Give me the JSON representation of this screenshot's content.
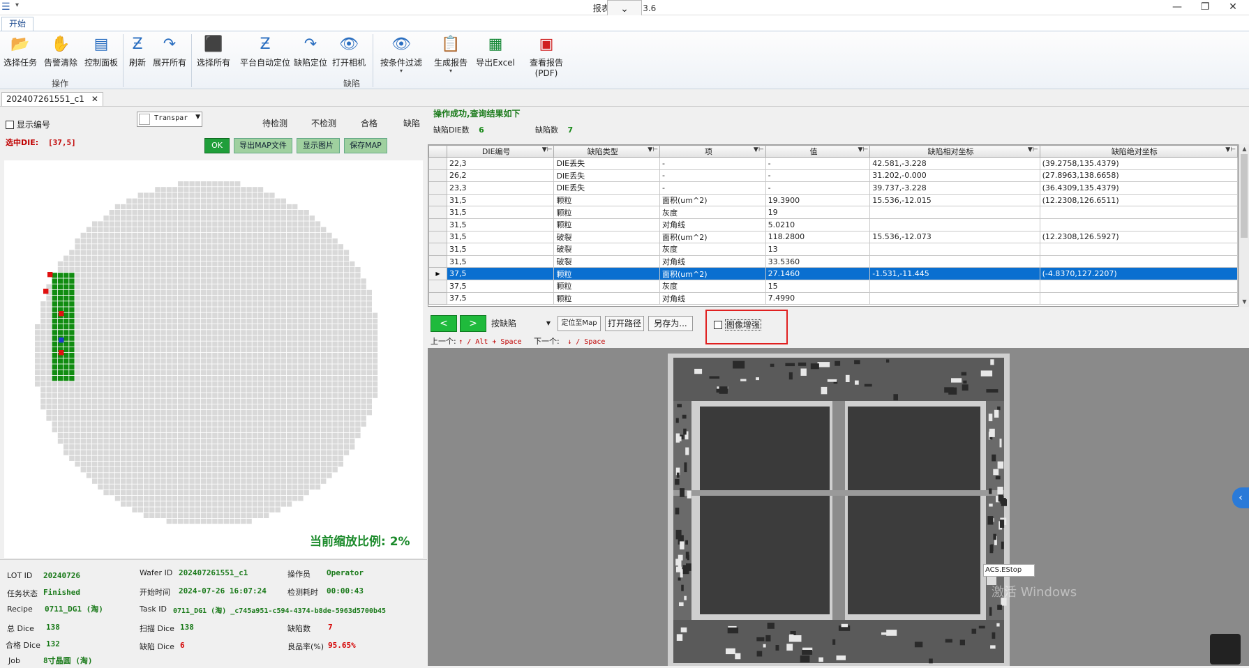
{
  "titlebar": {
    "title": "报表中心 V4.3.6",
    "restore": "❐",
    "minimize": "—",
    "close": "✕"
  },
  "ribbon": {
    "tab": "开始",
    "groups": [
      {
        "label": "操作"
      },
      {
        "label": "缺陷"
      }
    ],
    "buttons": {
      "select_task": "选择任务",
      "alarm_clear": "告警清除",
      "control_panel": "控制面板",
      "refresh": "刷新",
      "expand_all": "展开所有",
      "select_all": "选择所有",
      "platform_auto": "平台自动定位",
      "defect_locate": "缺陷定位",
      "open_camera": "打开相机",
      "filter_by": "按条件过滤",
      "gen_report": "生成报告",
      "export_excel": "导出Excel",
      "view_report_pdf": "查看报告(PDF)"
    }
  },
  "doc_tab": {
    "label": "202407261551_c1",
    "close": "✕"
  },
  "left": {
    "show_number": "显示编号",
    "transparency": "Transpar",
    "legend": [
      "待检测",
      "不检测",
      "合格",
      "缺陷"
    ],
    "selected_die_label": "选中DIE:",
    "selected_die_value": "[37,5]",
    "btn_ok": "OK",
    "btn_export_map": "导出MAP文件",
    "btn_show_image": "显示图片",
    "btn_save_map": "保存MAP",
    "zoom_text": "当前缩放比例: 2%"
  },
  "info": {
    "lot_id_label": "LOT ID",
    "lot_id": "20240726",
    "wafer_id_label": "Wafer ID",
    "wafer_id": "202407261551_c1",
    "operator_label": "操作员",
    "operator": "Operator",
    "task_status_label": "任务状态",
    "task_status": "Finished",
    "start_time_label": "开始时间",
    "start_time": "2024-07-26 16:07:24",
    "elapsed_label": "检测耗时",
    "elapsed": "00:00:43",
    "recipe_label": "Recipe",
    "recipe": "0711_DG1 (淘)",
    "task_id_label": "Task ID",
    "task_id": "0711_DG1 (淘) _c745a951-c594-4374-b8de-5963d5700b45",
    "total_dice_label": "总 Dice",
    "total_dice": "138",
    "scan_dice_label": "扫描 Dice",
    "scan_dice": "138",
    "defect_count_label": "缺陷数",
    "defect_count": "7",
    "good_dice_label": "合格 Dice",
    "good_dice": "132",
    "defect_dice_label": "缺陷 Dice",
    "defect_dice": "6",
    "yield_label": "良品率(%)",
    "yield": "95.65%",
    "job_label": "Job",
    "job": "8寸晶圆 (淘)"
  },
  "right": {
    "result_msg": "操作成功,查询结果如下",
    "defect_die_label": "缺陷DIE数",
    "defect_die": "6",
    "defect_num_label": "缺陷数",
    "defect_num": "7",
    "columns": [
      "DIE编号",
      "缺陷类型",
      "项",
      "值",
      "缺陷相对坐标",
      "缺陷绝对坐标"
    ],
    "rows": [
      {
        "die": "22,3",
        "type": "DIE丢失",
        "item": "-",
        "val": "-",
        "rel": "42.581,-3.228",
        "abs": "(39.2758,135.4379)"
      },
      {
        "die": "26,2",
        "type": "DIE丢失",
        "item": "-",
        "val": "-",
        "rel": "31.202,-0.000",
        "abs": "(27.8963,138.6658)"
      },
      {
        "die": "23,3",
        "type": "DIE丢失",
        "item": "-",
        "val": "-",
        "rel": "39.737,-3.228",
        "abs": "(36.4309,135.4379)"
      },
      {
        "die": "31,5",
        "type": "颗粒",
        "item": "面积(um^2)",
        "val": "19.3900",
        "rel": "15.536,-12.015",
        "abs": "(12.2308,126.6511)"
      },
      {
        "die": "31,5",
        "type": "颗粒",
        "item": "灰度",
        "val": "19",
        "rel": "",
        "abs": ""
      },
      {
        "die": "31,5",
        "type": "颗粒",
        "item": "对角线",
        "val": "5.0210",
        "rel": "",
        "abs": ""
      },
      {
        "die": "31,5",
        "type": "破裂",
        "item": "面积(um^2)",
        "val": "118.2800",
        "rel": "15.536,-12.073",
        "abs": "(12.2308,126.5927)"
      },
      {
        "die": "31,5",
        "type": "破裂",
        "item": "灰度",
        "val": "13",
        "rel": "",
        "abs": ""
      },
      {
        "die": "31,5",
        "type": "破裂",
        "item": "对角线",
        "val": "33.5360",
        "rel": "",
        "abs": ""
      },
      {
        "die": "37,5",
        "type": "颗粒",
        "item": "面积(um^2)",
        "val": "27.1460",
        "rel": "-1.531,-11.445",
        "abs": "(-4.8370,127.2207)"
      },
      {
        "die": "37,5",
        "type": "颗粒",
        "item": "灰度",
        "val": "15",
        "rel": "",
        "abs": ""
      },
      {
        "die": "37,5",
        "type": "颗粒",
        "item": "对角线",
        "val": "7.4990",
        "rel": "",
        "abs": ""
      }
    ],
    "prev_btn": "<",
    "next_btn": ">",
    "sort_select": "按缺陷",
    "btn_locate_map": "定位至Map",
    "btn_open_path": "打开路径",
    "btn_save_as": "另存为...",
    "image_enhance": "图像增强",
    "prev_hint_label": "上一个:",
    "prev_hint_keys": "↑ / Alt + Space",
    "next_hint_label": "下一个:",
    "next_hint_keys": "↓ / Space",
    "estop_label": "ACS.EStop",
    "watermark": "激活 Windows"
  },
  "colors": {
    "selected_row": "#0a6fd0",
    "green_die": "#118c11",
    "defect_die": "#e01010",
    "selected_die": "#1a3acc"
  }
}
